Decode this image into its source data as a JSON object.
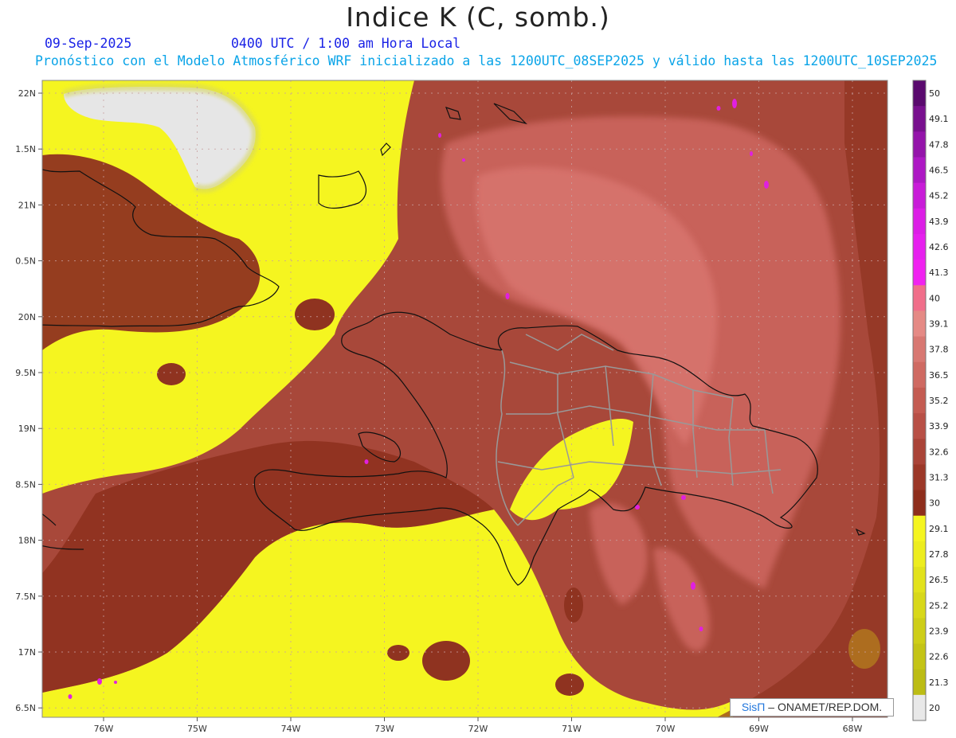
{
  "title": "Indice K (C, somb.)",
  "date_label": "09-Sep-2025",
  "time_label": "0400 UTC / 1:00 am Hora Local",
  "info_line": "Pronóstico con el Modelo Atmosférico WRF inicializado a las 1200UTC_08SEP2025 y válido hasta las  1200UTC_10SEP2025",
  "credit": {
    "brand": "SisΠ",
    "text": "– ONAMET/REP.DOM."
  },
  "map": {
    "lat_ticks": [
      "22N",
      "1.5N",
      "21N",
      "0.5N",
      "20N",
      "9.5N",
      "19N",
      "8.5N",
      "18N",
      "7.5N",
      "17N",
      "6.5N"
    ],
    "lon_ticks": [
      "76W",
      "75W",
      "74W",
      "73W",
      "72W",
      "71W",
      "70W",
      "69W",
      "68W"
    ],
    "lat_values": [
      22,
      21.5,
      21,
      20.5,
      20,
      19.5,
      19,
      18.5,
      18,
      17.5,
      17,
      16.5
    ],
    "lon_values": [
      -76,
      -75,
      -74,
      -73,
      -72,
      -71,
      -70,
      -69,
      -68
    ],
    "colors": {
      "yellow": "#f5f520",
      "dark_brown": "#8f3320",
      "mid_brown": "#a8483a",
      "light_red": "#c8625a",
      "pink_red": "#d97670",
      "magenta": "#e020e0",
      "land_gray": "#e6e6e6"
    }
  },
  "colorbar": {
    "labels": [
      "50",
      "49.1",
      "47.8",
      "46.5",
      "45.2",
      "43.9",
      "42.6",
      "41.3",
      "40",
      "39.1",
      "37.8",
      "36.5",
      "35.2",
      "33.9",
      "32.6",
      "31.3",
      "30",
      "29.1",
      "27.8",
      "26.5",
      "25.2",
      "23.9",
      "22.6",
      "21.3",
      "20"
    ],
    "colors": [
      "#5a0a6e",
      "#78108e",
      "#9414aa",
      "#ad18c4",
      "#c81cd8",
      "#dc1ee6",
      "#e620ee",
      "#f022f0",
      "#f06e8a",
      "#e58a85",
      "#d87872",
      "#cf6a62",
      "#c45c52",
      "#b85046",
      "#aa4438",
      "#9c3828",
      "#8e2e1c",
      "#f5f520",
      "#eded1e",
      "#e2e21c",
      "#d8d81a",
      "#cece18",
      "#c4c416",
      "#bcbc14",
      "#e8e8e8"
    ]
  }
}
